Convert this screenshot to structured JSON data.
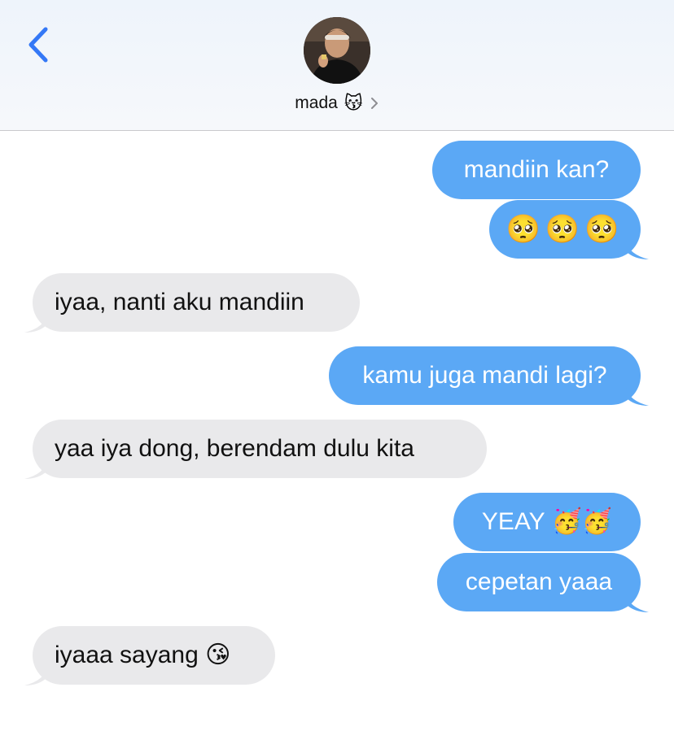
{
  "header": {
    "contact_name": "mada",
    "contact_emoji": "😽",
    "back_icon": "chevron-left-icon",
    "details_icon": "chevron-right-icon"
  },
  "colors": {
    "sent_bubble": "#5ba8f5",
    "received_bubble": "#e9e9eb",
    "accent": "#3478f6"
  },
  "messages": [
    {
      "direction": "sent",
      "text": "mandiin kan?"
    },
    {
      "direction": "sent",
      "text": "🥺🥺🥺"
    },
    {
      "direction": "received",
      "text": "iyaa, nanti aku mandiin"
    },
    {
      "direction": "sent",
      "text": "kamu juga mandi lagi?"
    },
    {
      "direction": "received",
      "text": "yaa iya dong, berendam dulu kita"
    },
    {
      "direction": "sent",
      "text": "YEAY 🥳🥳"
    },
    {
      "direction": "sent",
      "text": "cepetan yaaa"
    },
    {
      "direction": "received",
      "text": "iyaaa sayang 😘"
    }
  ]
}
